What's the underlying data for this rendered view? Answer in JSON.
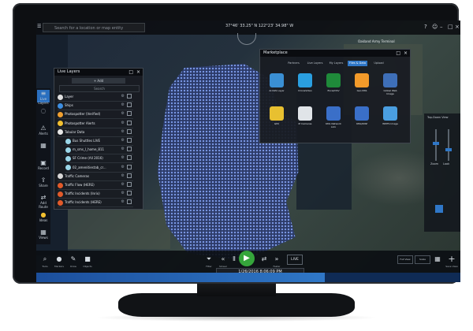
{
  "app": {
    "search_placeholder": "Search for a location or map entity",
    "coordinates": "37°46' 33.25\" N  122°23' 34.98\" W",
    "map_labels": [
      "Oakland Army Terminal"
    ]
  },
  "left_toolbar": {
    "items": [
      {
        "label": "Live Layers",
        "icon": "layers-icon",
        "active": true
      },
      {
        "label": "",
        "icon": "warning-icon",
        "active": false
      },
      {
        "label": "Alerts",
        "icon": "alert-icon",
        "active": false
      },
      {
        "label": "",
        "icon": "calendar-icon",
        "active": false
      },
      {
        "label": "Record",
        "icon": "record-icon",
        "active": false
      },
      {
        "label": "Share",
        "icon": "share-icon",
        "active": false
      },
      {
        "label": "Add Route",
        "icon": "route-icon",
        "active": false
      },
      {
        "label": "Ideas",
        "icon": "bulb-icon",
        "active": false
      },
      {
        "label": "Views",
        "icon": "grid-icon",
        "active": false
      }
    ]
  },
  "live_layers": {
    "title": "Live Layers",
    "add_label": "+ Add",
    "search_placeholder": "Search",
    "rows": [
      {
        "label": "Layer",
        "color": "#e0e0e0",
        "sub": false
      },
      {
        "label": "Ships",
        "color": "#3d8ee0",
        "sub": false
      },
      {
        "label": "Photospotter (Verified)",
        "color": "#f0a030",
        "sub": false
      },
      {
        "label": "Photospotter Alerts",
        "color": "#f2c030",
        "sub": false
      },
      {
        "label": "Tabular Data",
        "color": "#e8e8e8",
        "sub": false
      },
      {
        "label": "Bus Shuttles LIVE",
        "color": "#9ad6e8",
        "sub": true
      },
      {
        "label": "m_sms_l_home_811",
        "color": "#9ad6e8",
        "sub": true
      },
      {
        "label": "SF Crime (All 2016)",
        "color": "#9ad6e8",
        "sub": true
      },
      {
        "label": "02_amenitiestab_cr...",
        "color": "#9ad6e8",
        "sub": true
      },
      {
        "label": "Traffic Cameras",
        "color": "#d8d8d8",
        "sub": false
      },
      {
        "label": "Traffic Flow (HERE)",
        "color": "#e25a2a",
        "sub": false
      },
      {
        "label": "Traffic Incidents (Inrix)",
        "color": "#e25a2a",
        "sub": false
      },
      {
        "label": "Traffic Incidents (HERE)",
        "color": "#e25a2a",
        "sub": false
      }
    ]
  },
  "marketplace": {
    "title": "Marketplace",
    "tabs": [
      {
        "label": "Partners",
        "selected": false
      },
      {
        "label": "Live Layers",
        "selected": false
      },
      {
        "label": "My Layers",
        "selected": false
      },
      {
        "label": "Files & Data",
        "selected": true
      },
      {
        "label": "Upload",
        "selected": false
      }
    ],
    "tiles": [
      {
        "label": "ArcGIS Layer",
        "color": "#3a8fd4"
      },
      {
        "label": "DroneVideo",
        "color": "#2a9fe0"
      },
      {
        "label": "Excel/CSV",
        "color": "#1f8a3a"
      },
      {
        "label": "Geo RSS",
        "color": "#f29a2a"
      },
      {
        "label": "Global Web Image",
        "color": "#3e6fb8"
      },
      {
        "label": "GPX",
        "color": "#e8c030"
      },
      {
        "label": "IP Cameras",
        "color": "#e0e4e8"
      },
      {
        "label": "KML Network Link",
        "color": "#3a6fc8"
      },
      {
        "label": "KML/KMZ",
        "color": "#3a6fc8"
      },
      {
        "label": "WMTS Image",
        "color": "#4a9ee0"
      }
    ]
  },
  "right_panel": {
    "title": "Top-Down View",
    "labels": [
      "Zoom",
      "Look"
    ]
  },
  "bottom_toolbar": {
    "left_items": [
      "Tools",
      "Markers",
      "Draw",
      "Objects"
    ],
    "transport": [
      "Filter",
      "Slower",
      "Pause",
      "Play",
      "Faster",
      "Loop"
    ],
    "live_label": "LIVE",
    "datetime": "1/26/2016 8:06:09 PM",
    "right_items": [
      "Full View",
      "Scale",
      "Grid",
      "Save View"
    ],
    "timestamp_hint": "1/26/2016",
    "timeline_progress": 0.68
  }
}
